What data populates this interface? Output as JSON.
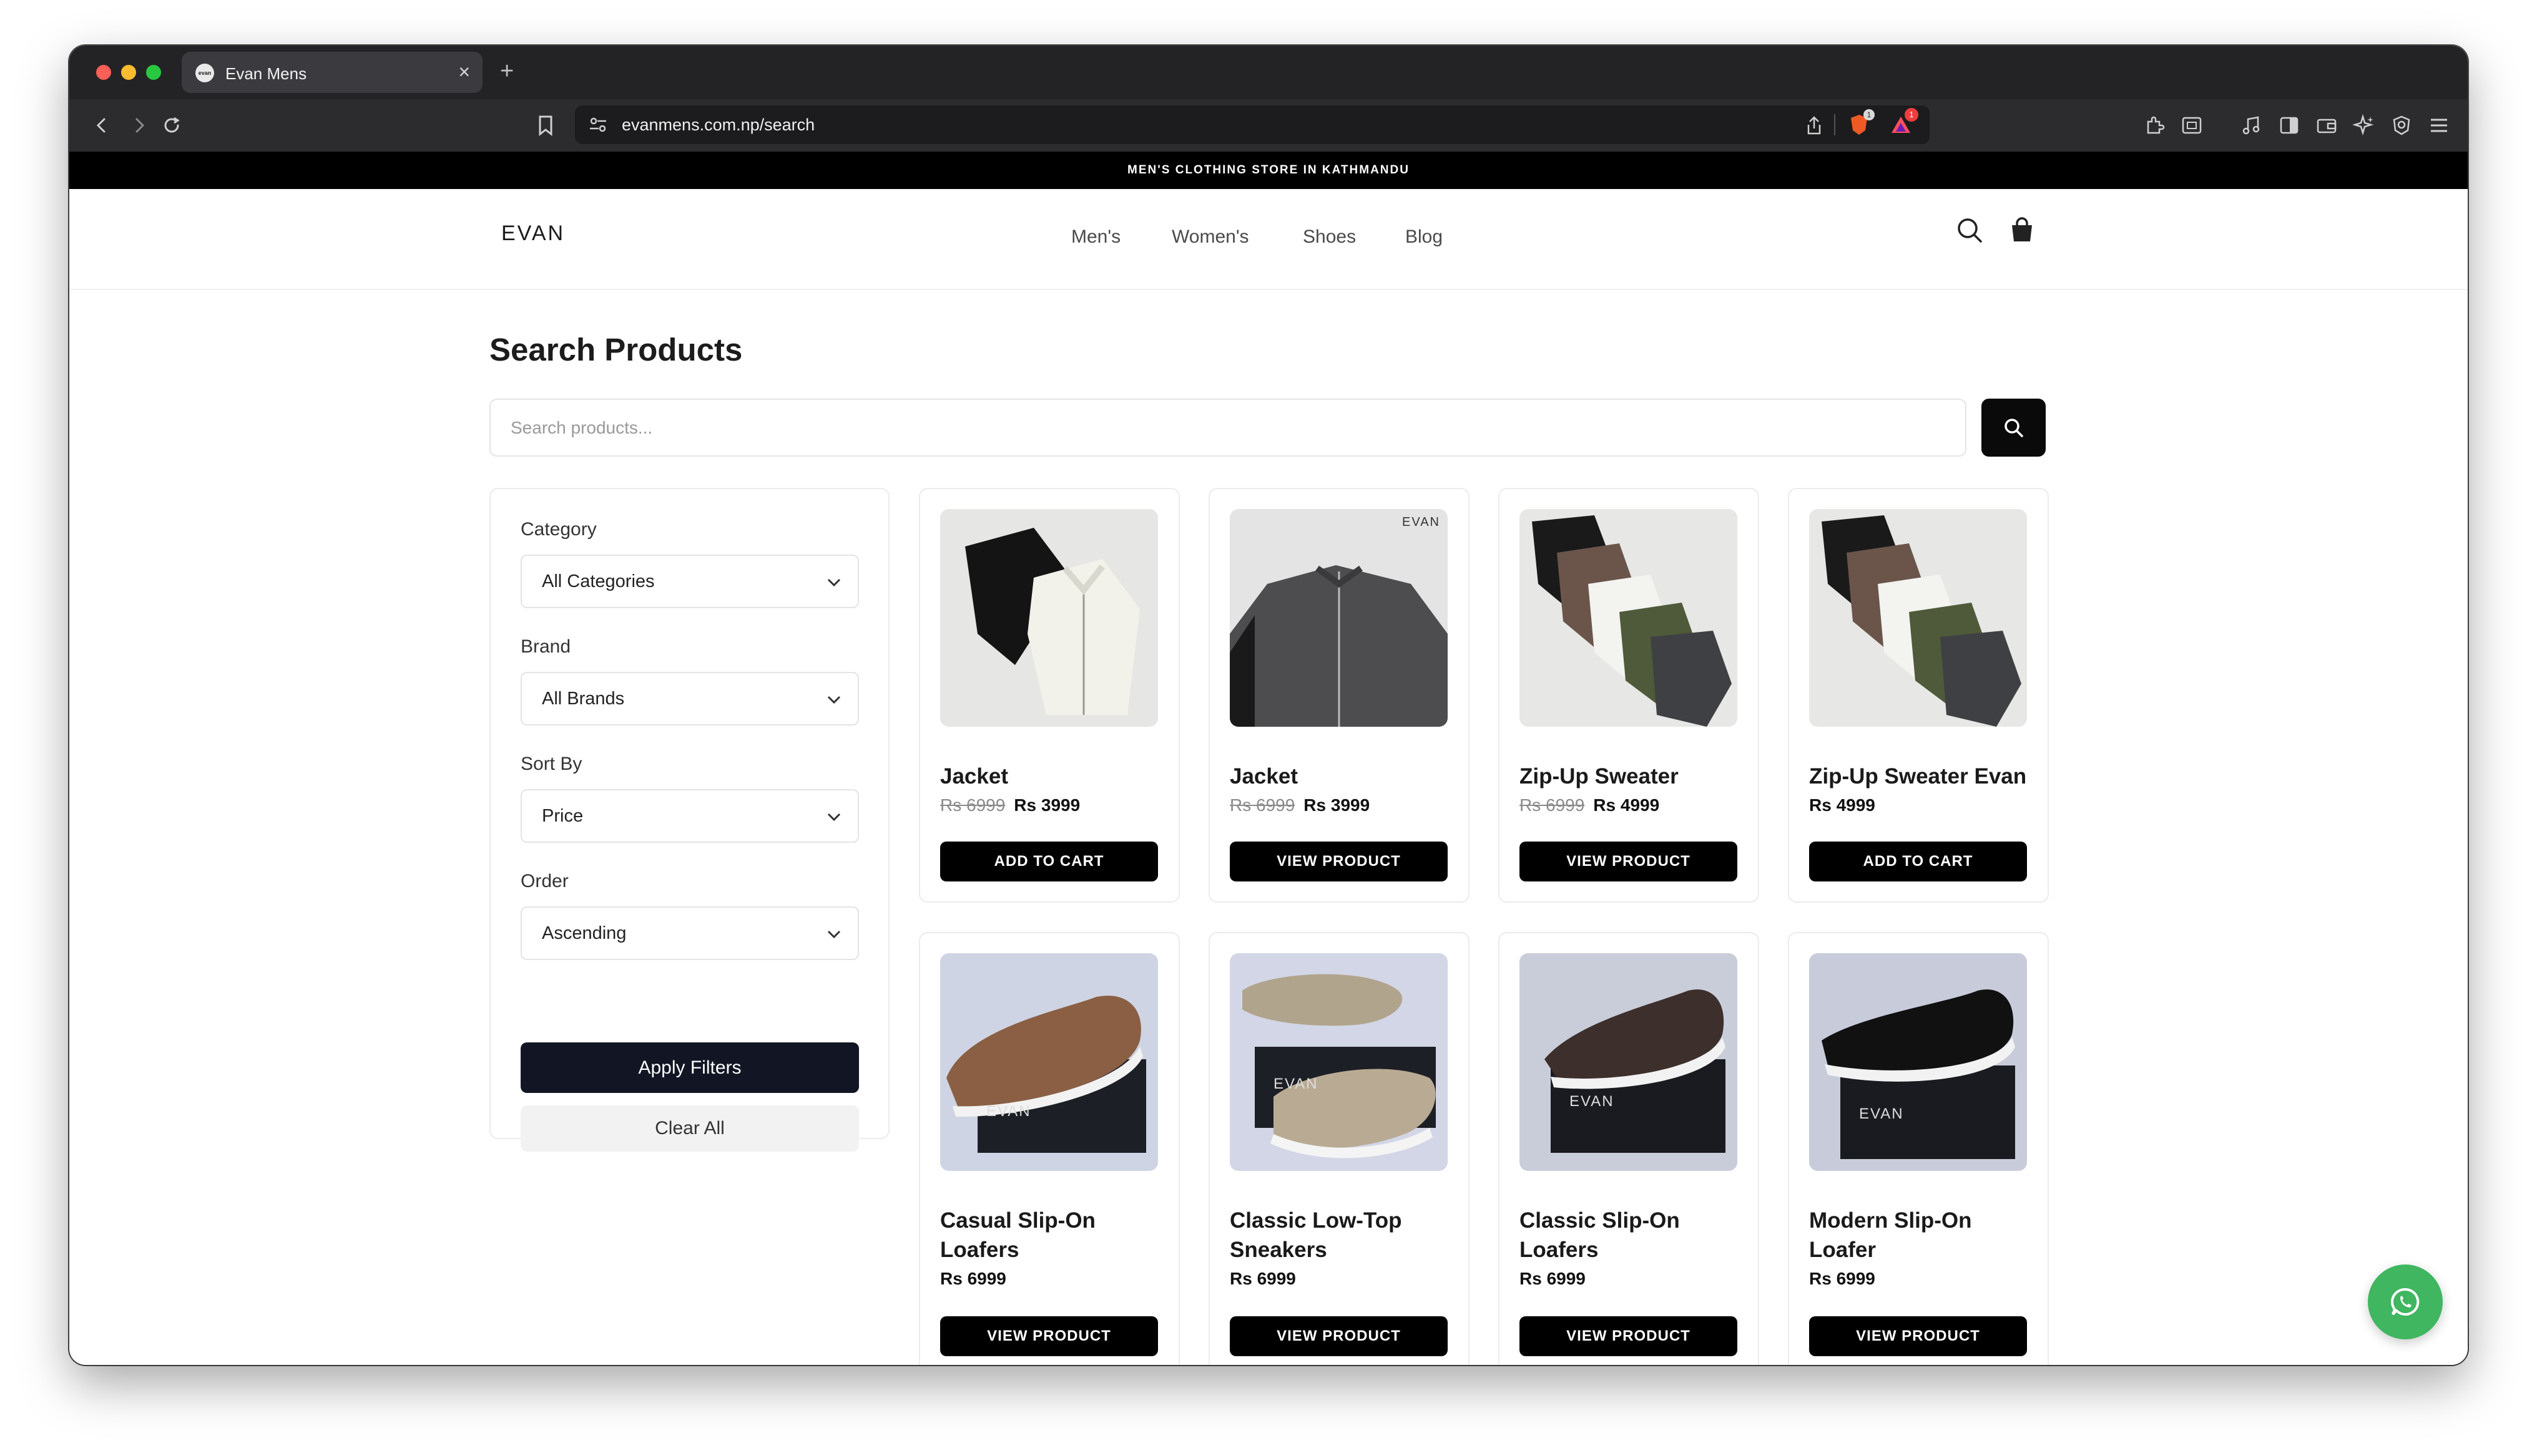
{
  "browser": {
    "tab_title": "Evan Mens",
    "tab_favicon": "evan",
    "url": "evanmens.com.np/search",
    "shield_badge": "1",
    "rewards_badge": "1"
  },
  "site": {
    "announcement": "MEN'S CLOTHING STORE IN KATHMANDU",
    "logo": "EVAN",
    "nav": [
      "Men's",
      "Women's",
      "Shoes",
      "Blog"
    ]
  },
  "search": {
    "title": "Search Products",
    "placeholder": "Search products..."
  },
  "filters": {
    "category_label": "Category",
    "category_value": "All Categories",
    "brand_label": "Brand",
    "brand_value": "All Brands",
    "sort_label": "Sort By",
    "sort_value": "Price",
    "order_label": "Order",
    "order_value": "Ascending",
    "apply_label": "Apply Filters",
    "clear_label": "Clear All"
  },
  "products": [
    {
      "name": "Jacket",
      "old_price": "Rs 6999",
      "price": "Rs 3999",
      "button": "ADD TO CART"
    },
    {
      "name": "Jacket",
      "old_price": "Rs 6999",
      "price": "Rs 3999",
      "button": "VIEW PRODUCT",
      "watermark": "EVAN"
    },
    {
      "name": "Zip-Up Sweater",
      "old_price": "Rs 6999",
      "price": "Rs 4999",
      "button": "VIEW PRODUCT"
    },
    {
      "name": "Zip-Up Sweater Evan",
      "price": "Rs 4999",
      "button": "ADD TO CART"
    },
    {
      "name": "Casual Slip-On Loafers",
      "price": "Rs 6999",
      "button": "VIEW PRODUCT",
      "box_logo": "EVAN"
    },
    {
      "name": "Classic Low-Top Sneakers",
      "price": "Rs 6999",
      "button": "VIEW PRODUCT",
      "box_logo": "EVAN"
    },
    {
      "name": "Classic Slip-On Loafers",
      "price": "Rs 6999",
      "button": "VIEW PRODUCT",
      "box_logo": "EVAN"
    },
    {
      "name": "Modern Slip-On Loafer",
      "price": "Rs 6999",
      "button": "VIEW PRODUCT",
      "box_logo": "EVAN"
    }
  ],
  "icons": {
    "search": "search-icon",
    "cart": "shopping-bag-icon",
    "chat": "whatsapp-icon"
  },
  "colors": {
    "accent_dark": "#121624",
    "whatsapp": "#3fb65f"
  }
}
